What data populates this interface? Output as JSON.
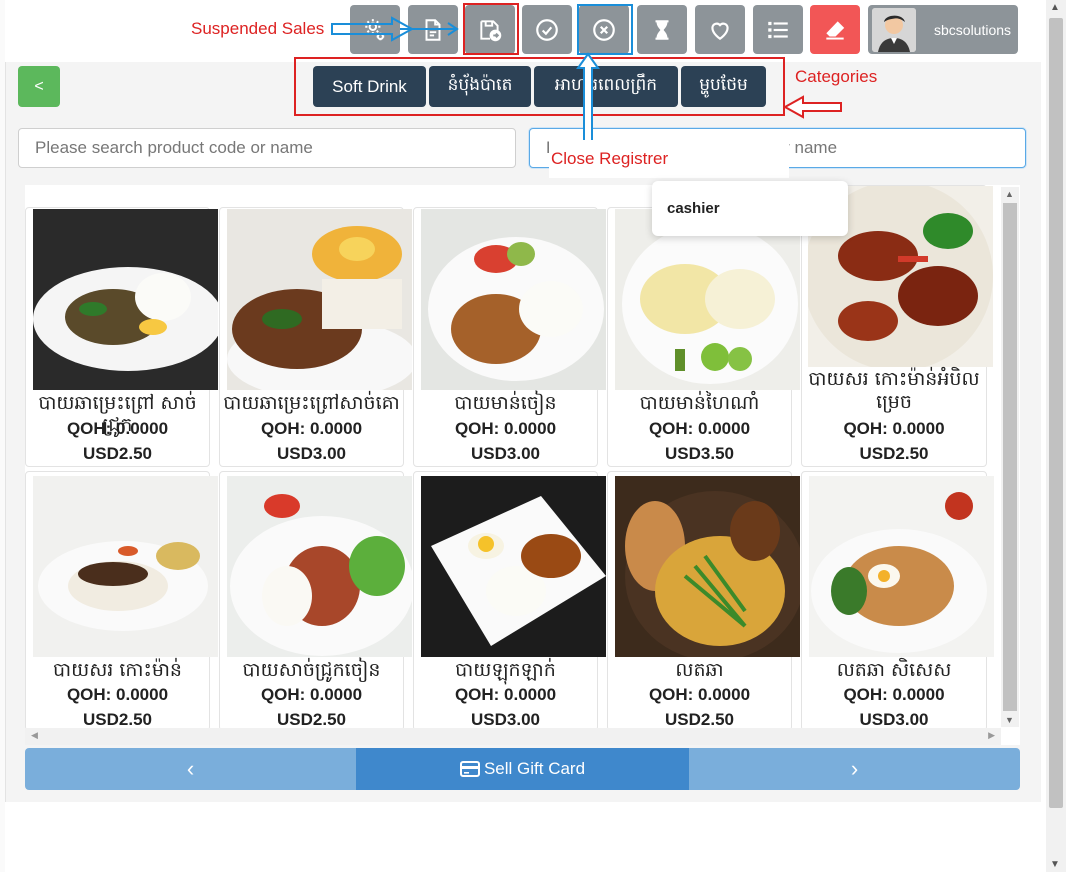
{
  "toolbar": {
    "buttons": [
      {
        "icon": "settings-icon"
      },
      {
        "icon": "document-icon"
      },
      {
        "icon": "suspended-sales-icon"
      },
      {
        "icon": "check-circle-icon"
      },
      {
        "icon": "close-circle-icon"
      },
      {
        "icon": "hourglass-icon"
      },
      {
        "icon": "heart-icon"
      },
      {
        "icon": "list-icon"
      },
      {
        "icon": "eraser-icon"
      }
    ],
    "user": {
      "name": "sbcsolutions"
    }
  },
  "annotations": {
    "suspended_sales": "Suspended Sales",
    "categories": "Categories",
    "close_register": "Close Registrer",
    "color": "#dd2222"
  },
  "back_button": {
    "label": "<"
  },
  "categories": [
    {
      "label": "Soft Drink"
    },
    {
      "label": "នំបុ័ងប៉ាតេ"
    },
    {
      "label": "អាហារពេលព្រឹក"
    },
    {
      "label": "ម្ហូបថែម"
    }
  ],
  "search": {
    "product_placeholder": "Please search product code or name",
    "customer_placeholder": "Please search customer code or name"
  },
  "dropdown": {
    "option": "cashier"
  },
  "products": [
    {
      "name": "បាយឆាម្រេះព្រៅ សាច់ជ្រូក",
      "qoh": "QOH: 0.0000",
      "price": "USD2.50"
    },
    {
      "name": "បាយឆាម្រេះព្រៅសាច់គោ",
      "qoh": "QOH: 0.0000",
      "price": "USD3.00"
    },
    {
      "name": "បាយមាន់ចៀន",
      "qoh": "QOH: 0.0000",
      "price": "USD3.00"
    },
    {
      "name": "បាយមាន់ហៃណាំ",
      "qoh": "QOH: 0.0000",
      "price": "USD3.50"
    },
    {
      "name": "បាយសរ កោះម៉ាន់អំបិលម្រេច",
      "qoh": "QOH: 0.0000",
      "price": "USD2.50"
    },
    {
      "name": "បាយសរ កោះម៉ាន់",
      "qoh": "QOH: 0.0000",
      "price": "USD2.50"
    },
    {
      "name": "បាយសាច់ជ្រូកចៀន",
      "qoh": "QOH: 0.0000",
      "price": "USD2.50"
    },
    {
      "name": "បាយឡុកឡាក់",
      "qoh": "QOH: 0.0000",
      "price": "USD3.00"
    },
    {
      "name": "លតឆា",
      "qoh": "QOH: 0.0000",
      "price": "USD2.50"
    },
    {
      "name": "លតឆា សិសេស",
      "qoh": "QOH: 0.0000",
      "price": "USD3.00"
    }
  ],
  "bottom_bar": {
    "prev_label": "‹",
    "gift_card_label": "Sell Gift Card",
    "next_label": "›"
  },
  "colors": {
    "toolbar_button": "#8d9499",
    "eraser_button": "#f25656",
    "category_button": "#2c4155",
    "back_button": "#5cb85c",
    "gift_card": "#3f88cc",
    "pager": "#7aaedb"
  }
}
